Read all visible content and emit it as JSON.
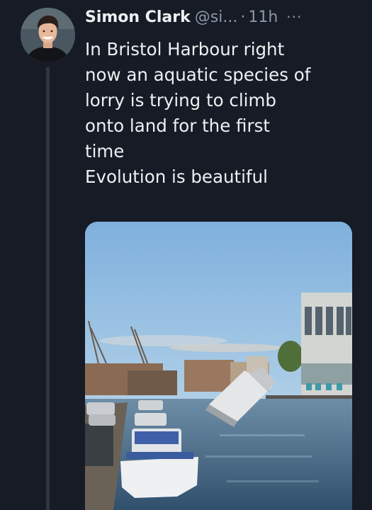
{
  "tweet": {
    "author_name": "Simon Clark",
    "handle": "@si...",
    "separator": "·",
    "time": "11h",
    "more_glyph": "···",
    "text_lines": [
      "In Bristol Harbour right",
      "now an aquatic species of",
      "lorry is trying to climb",
      "onto land for the first",
      "time",
      "Evolution is beautiful"
    ]
  },
  "icons": {
    "more": "more-options-icon",
    "avatar": "profile-avatar"
  },
  "colors": {
    "background": "#161b26",
    "text": "#e7e9ea",
    "muted": "#8b98a5",
    "thread_line": "#2e3640"
  }
}
